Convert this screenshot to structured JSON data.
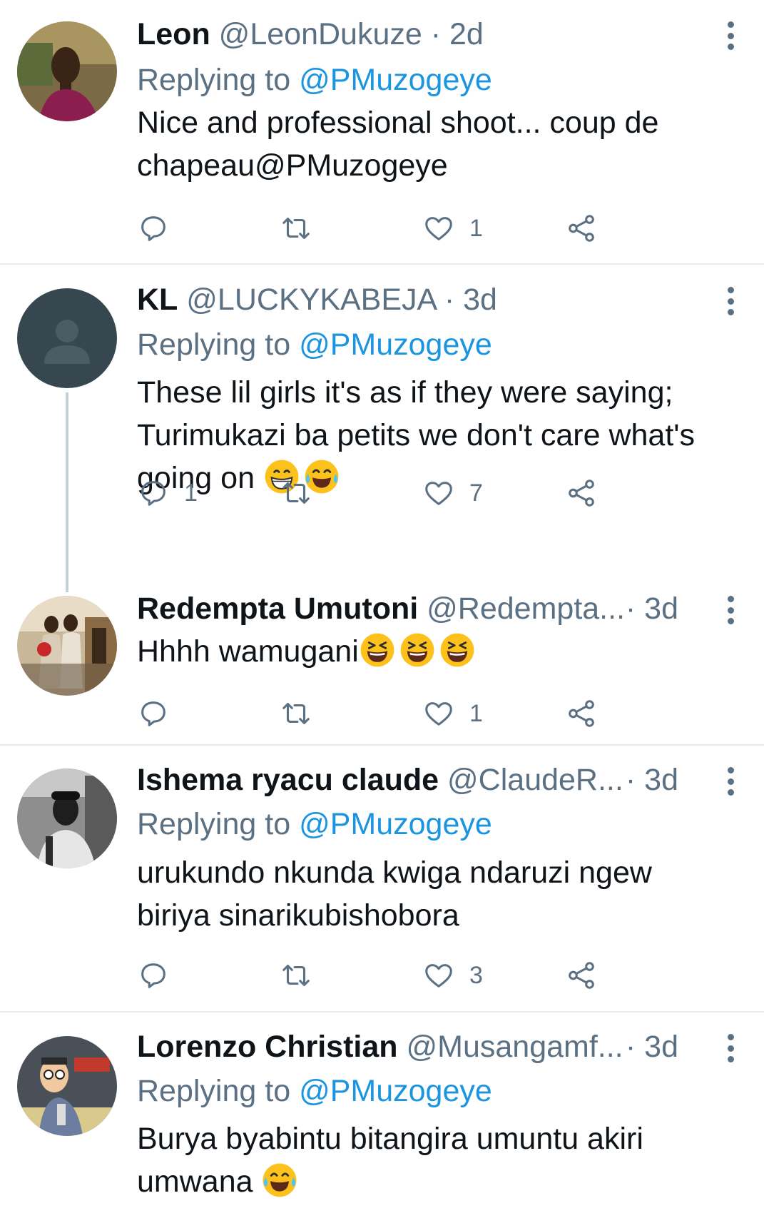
{
  "tweets": [
    {
      "name": "Leon",
      "handle": "@LeonDukuze",
      "time": "· 2d",
      "replying_prefix": "Replying to ",
      "replying_to": "@PMuzogeye",
      "text_lines": [
        "Nice and professional shoot... coup de",
        "chapeau@PMuzogeye"
      ],
      "replies": "",
      "likes": "1"
    },
    {
      "name": "KL",
      "handle": "@LUCKYKABEJA",
      "time": "· 3d",
      "replying_prefix": "Replying to ",
      "replying_to": "@PMuzogeye",
      "text_lines": [
        "These lil girls it's as if they were saying;",
        "Turimukazi ba petits we don't care what's",
        "going on "
      ],
      "replies": "1",
      "likes": "7"
    },
    {
      "name": "Redempta Umutoni",
      "handle": "@Redempta...",
      "time": "· 3d",
      "text_lines": [
        "Hhhh wamugani"
      ],
      "replies": "",
      "likes": "1"
    },
    {
      "name": "Ishema ryacu claude",
      "handle": "@ClaudeR...",
      "time": "· 3d",
      "replying_prefix": "Replying to ",
      "replying_to": "@PMuzogeye",
      "text_lines": [
        "urukundo nkunda kwiga ndaruzi ngew",
        "biriya sinarikubishobora"
      ],
      "replies": "",
      "likes": "3"
    },
    {
      "name": "Lorenzo Christian",
      "handle": "@Musangamf...",
      "time": "· 3d",
      "replying_prefix": "Replying to ",
      "replying_to": "@PMuzogeye",
      "text_lines": [
        "Burya byabintu bitangira umuntu akiri",
        "umwana "
      ]
    }
  ],
  "icons": {
    "reply": "reply-icon",
    "retweet": "retweet-icon",
    "like": "heart-icon",
    "share": "share-icon",
    "more": "more-vertical-icon",
    "emoji_grin": "grinning-face-emoji",
    "emoji_tears": "tears-of-joy-emoji",
    "emoji_squint": "squinting-face-emoji"
  },
  "colors": {
    "mention": "#1b95e0",
    "secondary_text": "#5b7083",
    "divider": "#e6ecf0",
    "primary_text": "#0f1419"
  }
}
